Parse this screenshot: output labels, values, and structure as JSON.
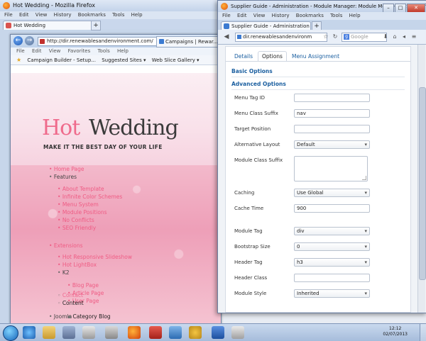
{
  "bg_firefox": {
    "title": "Hot Wedding - Mozilla Firefox",
    "menu": [
      "File",
      "Edit",
      "View",
      "History",
      "Bookmarks",
      "Tools",
      "Help"
    ],
    "tab_label": "Hot Wedding",
    "newtab_label": "+"
  },
  "ie": {
    "address": "http://dir.renewablesandenvironment.com/",
    "tab_label": "Campaigns | Rewar...",
    "menu": [
      "File",
      "Edit",
      "View",
      "Favorites",
      "Tools",
      "Help"
    ],
    "favorites": [
      "Campaign Builder - Setup...",
      "Suggested Sites ▾",
      "Web Slice Gallery ▾"
    ]
  },
  "site": {
    "logo_hot": "Hot",
    "logo_wedding": "Wedding",
    "tagline": "MAKE IT THE BEST DAY OF YOUR LIFE",
    "nav": {
      "home": "Home Page",
      "features": "Features",
      "about": "About Template",
      "colors": "Infinite Color Schemes",
      "menu": "Menu System",
      "module_positions": "Module Positions",
      "no_conflicts": "No Conflicts",
      "seo": "SEO Friendly",
      "extensions": "Extensions",
      "slideshow": "Hot Responsive Slideshow",
      "lightbox": "Hot LightBox",
      "k2": "K2",
      "blog": "Blog Page",
      "article": "Article Page",
      "user": "User Page",
      "joomla": "Joomla",
      "contact": "Contact",
      "content": "Content",
      "category_blog": "Category Blog"
    }
  },
  "fg_firefox": {
    "title": "Supplier Guide - Administration - Module Manager: Module Menu - Mozilla Firefox",
    "menu": [
      "File",
      "Edit",
      "View",
      "History",
      "Bookmarks",
      "Tools",
      "Help"
    ],
    "tab_label": "Supplier Guide - Administration - Modul...",
    "url": "dir.renewablesandenvironm",
    "search_placeholder": "Google",
    "newtab_label": "+"
  },
  "module": {
    "tabs": [
      "Details",
      "Options",
      "Menu Assignment"
    ],
    "active_tab": "Options",
    "basic_options": "Basic Options",
    "advanced_options": "Advanced Options",
    "fields": {
      "menu_tag_id": {
        "label": "Menu Tag ID",
        "value": ""
      },
      "menu_class_suffix": {
        "label": "Menu Class Suffix",
        "value": "nav"
      },
      "target_position": {
        "label": "Target Position",
        "value": ""
      },
      "alternative_layout": {
        "label": "Alternative Layout",
        "value": "Default"
      },
      "module_class_suffix": {
        "label": "Module Class Suffix",
        "value": ""
      },
      "caching": {
        "label": "Caching",
        "value": "Use Global"
      },
      "cache_time": {
        "label": "Cache Time",
        "value": "900"
      },
      "module_tag": {
        "label": "Module Tag",
        "value": "div"
      },
      "bootstrap_size": {
        "label": "Bootstrap Size",
        "value": "0"
      },
      "header_tag": {
        "label": "Header Tag",
        "value": "h3"
      },
      "header_class": {
        "label": "Header Class",
        "value": ""
      },
      "module_style": {
        "label": "Module Style",
        "value": "Inherited"
      }
    }
  },
  "taskbar": {
    "time": "12:12",
    "date": "02/07/2013"
  },
  "colors": {
    "brand_pink": "#ef6b8c",
    "link_blue": "#1b5fa0"
  }
}
